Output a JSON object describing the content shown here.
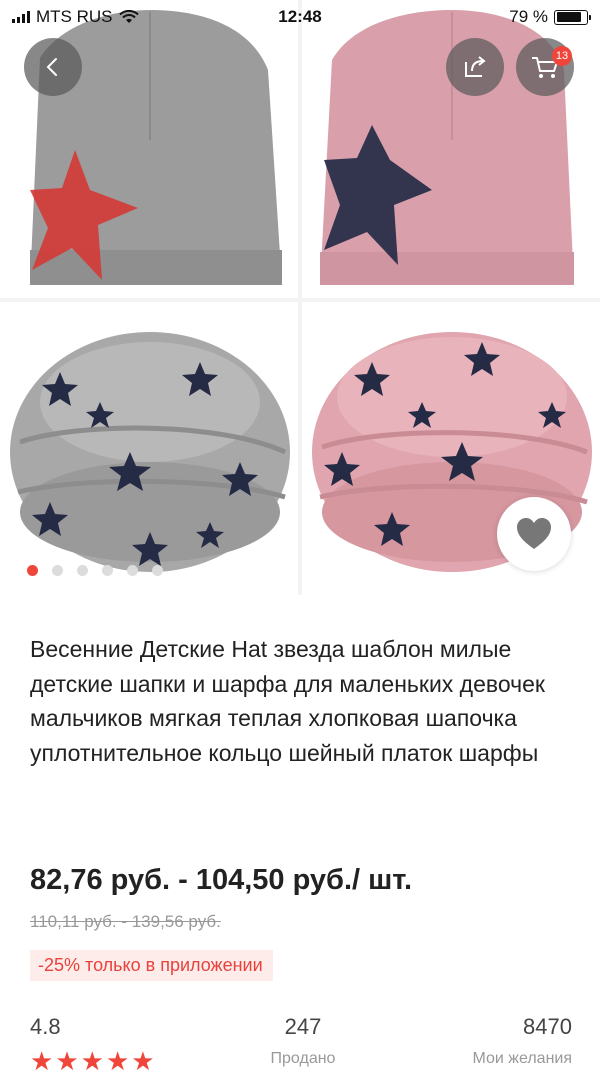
{
  "status_bar": {
    "carrier": "MTS RUS",
    "time": "12:48",
    "battery": "79 %"
  },
  "gallery": {
    "cart_count": "13",
    "page_count": 6,
    "active_page": 1
  },
  "product": {
    "title": "Весенние Детские Hat звезда шаблон милые детские шапки и шарфа для маленьких девочек мальчиков мягкая теплая хлопковая шапочка уплотнительное кольцо шейный платок шарфы",
    "price": "82,76 руб. - 104,50 руб./ шт.",
    "old_price": "110,11 руб. - 139,56 руб.",
    "promo": "-25% только в приложении"
  },
  "stats": {
    "rating": "4.8",
    "rating_stars": 5,
    "sold_count": "247",
    "sold_label": "Продано",
    "wish_count": "8470",
    "wish_label": "Мои желания"
  },
  "colors": {
    "accent": "#f0453a",
    "gray_fabric": "#9c9c9c",
    "pink_fabric": "#d9a0ab",
    "star_navy": "#252a45",
    "star_red": "#d43a35"
  }
}
